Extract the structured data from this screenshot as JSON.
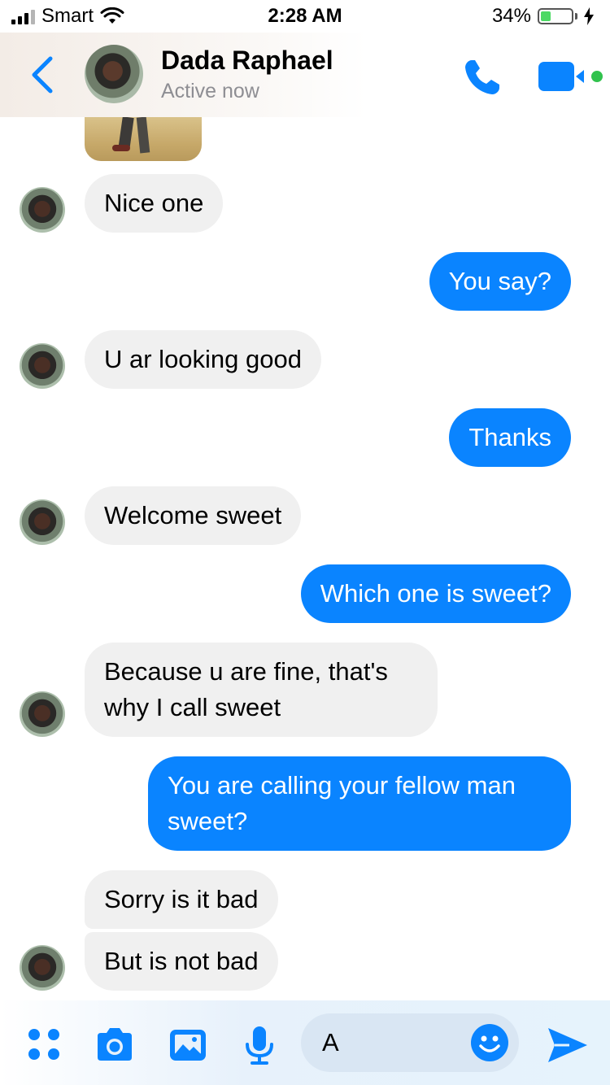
{
  "status_bar": {
    "carrier": "Smart",
    "time": "2:28 AM",
    "battery_percent": "34%",
    "battery_level": 0.34,
    "signal_bars_active": 3,
    "signal_bars_total": 4
  },
  "header": {
    "contact_name": "Dada Raphael",
    "presence": "Active now"
  },
  "messages": [
    {
      "from": "them",
      "text": "Nice one"
    },
    {
      "from": "me",
      "text": "You say?"
    },
    {
      "from": "them",
      "text": "U ar looking good"
    },
    {
      "from": "me",
      "text": "Thanks"
    },
    {
      "from": "them",
      "text": "Welcome sweet"
    },
    {
      "from": "me",
      "text": "Which one is sweet?"
    },
    {
      "from": "them",
      "text": "Because u are fine, that's why I call sweet"
    },
    {
      "from": "me",
      "text": "You are calling your fellow man sweet?"
    },
    {
      "from": "them",
      "text": "Sorry is it bad"
    },
    {
      "from": "them",
      "text": "But is not bad"
    }
  ],
  "composer": {
    "input_value": "A"
  },
  "icons": {
    "back": "chevron-left-icon",
    "call": "phone-icon",
    "video": "video-camera-icon",
    "apps": "four-dots-icon",
    "camera": "camera-icon",
    "gallery": "image-icon",
    "mic": "microphone-icon",
    "emoji": "smiley-icon",
    "send": "send-arrow-icon"
  },
  "colors": {
    "accent": "#0a84ff",
    "incoming_bubble": "#f0f0f0",
    "online_dot": "#31c24d",
    "battery_fill": "#4cd964"
  }
}
